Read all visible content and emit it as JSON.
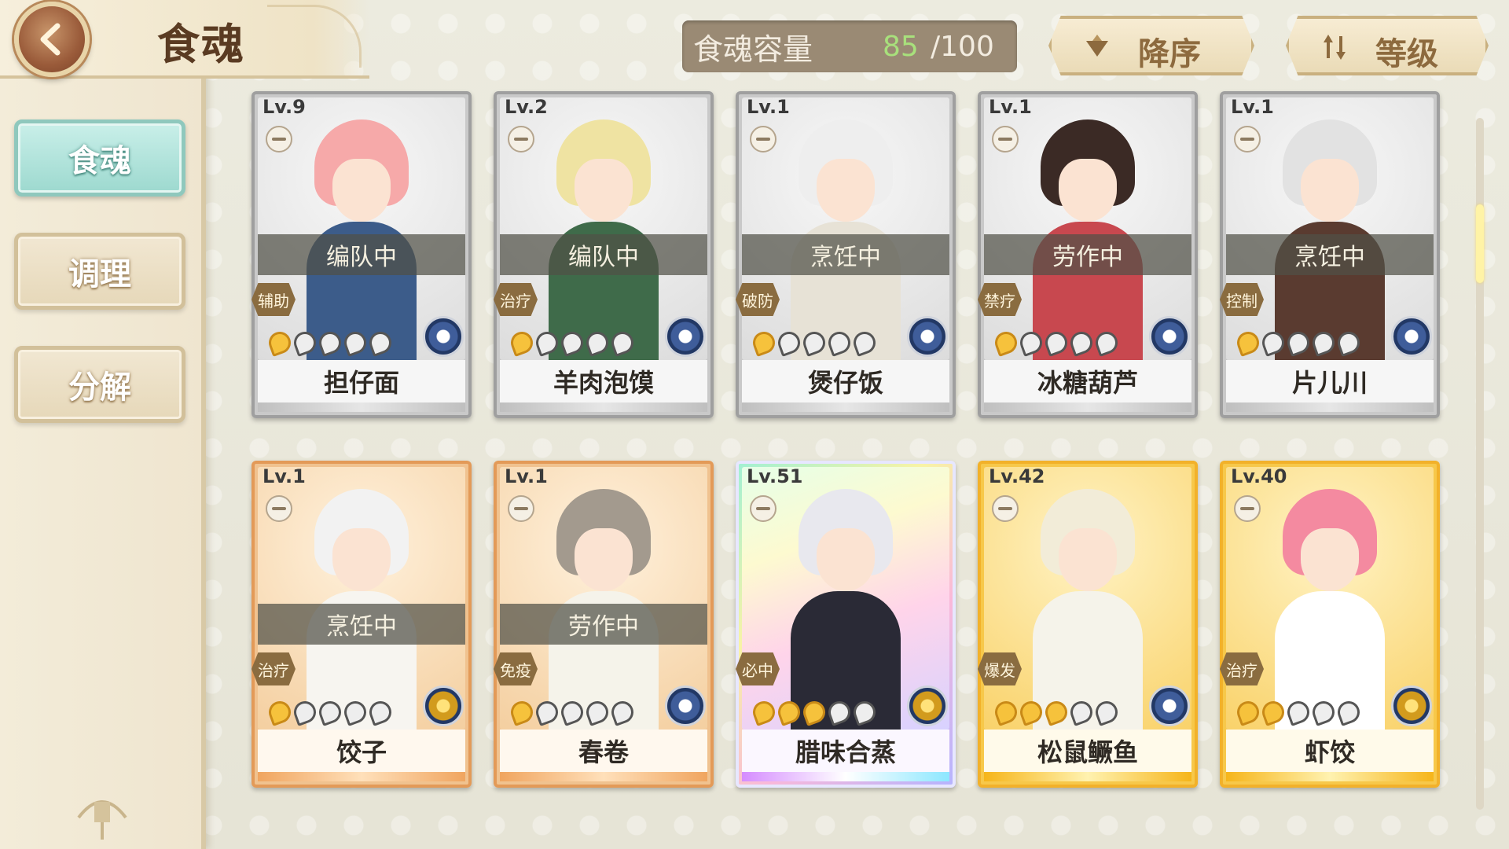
{
  "header": {
    "title": "食魂",
    "back_icon": "back-arrow-icon"
  },
  "sidebar": {
    "items": [
      {
        "label": "食魂",
        "active": true
      },
      {
        "label": "调理",
        "active": false
      },
      {
        "label": "分解",
        "active": false
      }
    ]
  },
  "capacity": {
    "label": "食魂容量",
    "current": "85",
    "max": "/100"
  },
  "sort": {
    "order_label": "降序",
    "order_icon": "descending-triangle-icon",
    "field_label": "等级",
    "field_icon": "sort-arrows-icon"
  },
  "colors": {
    "active_tab": "#9dd9cf",
    "capacity_current": "#a8e07c",
    "rarity_common": "#c9c9c9",
    "rarity_rare": "#f0c28f",
    "rarity_rainbow": "#f9b8d9",
    "rarity_gold": "#f7c84a"
  },
  "cards": [
    {
      "level": "Lv.9",
      "status": "编队中",
      "role": "辅助",
      "stars": 1,
      "name": "担仔面",
      "rarity": "r1",
      "hair": "#f6a9a9",
      "outfit": "#3c5c8a",
      "emblem": "blue"
    },
    {
      "level": "Lv.2",
      "status": "编队中",
      "role": "治疗",
      "stars": 1,
      "name": "羊肉泡馍",
      "rarity": "r1",
      "hair": "#efe3a2",
      "outfit": "#3f6b4a",
      "emblem": "blue"
    },
    {
      "level": "Lv.1",
      "status": "烹饪中",
      "role": "破防",
      "stars": 1,
      "name": "煲仔饭",
      "rarity": "r1",
      "hair": "#eeeeee",
      "outfit": "#e7e2d6",
      "emblem": "blue"
    },
    {
      "level": "Lv.1",
      "status": "劳作中",
      "role": "禁疗",
      "stars": 1,
      "name": "冰糖葫芦",
      "rarity": "r1",
      "hair": "#3b2a25",
      "outfit": "#c8484f",
      "emblem": "blue"
    },
    {
      "level": "Lv.1",
      "status": "烹饪中",
      "role": "控制",
      "stars": 1,
      "name": "片儿川",
      "rarity": "r1",
      "hair": "#e2e2e2",
      "outfit": "#5a3b30",
      "emblem": "blue"
    },
    {
      "level": "Lv.1",
      "status": "烹饪中",
      "role": "治疗",
      "stars": 1,
      "name": "饺子",
      "rarity": "r2",
      "hair": "#f2f2f2",
      "outfit": "#f7f5f0",
      "emblem": "gold"
    },
    {
      "level": "Lv.1",
      "status": "劳作中",
      "role": "免疫",
      "stars": 1,
      "name": "春卷",
      "rarity": "r2",
      "hair": "#a39a8e",
      "outfit": "#f5f3ea",
      "emblem": "blue"
    },
    {
      "level": "Lv.51",
      "status": "",
      "role": "必中",
      "stars": 3,
      "name": "腊味合蒸",
      "rarity": "r3",
      "hair": "#e8e8ee",
      "outfit": "#2a2a36",
      "emblem": "gold"
    },
    {
      "level": "Lv.42",
      "status": "",
      "role": "爆发",
      "stars": 3,
      "name": "松鼠鳜鱼",
      "rarity": "r4",
      "hair": "#f2ecd8",
      "outfit": "#f5f3ea",
      "emblem": "blue"
    },
    {
      "level": "Lv.40",
      "status": "",
      "role": "治疗",
      "stars": 2,
      "name": "虾饺",
      "rarity": "r4",
      "hair": "#f48aa0",
      "outfit": "#ffffff",
      "emblem": "gold"
    }
  ]
}
